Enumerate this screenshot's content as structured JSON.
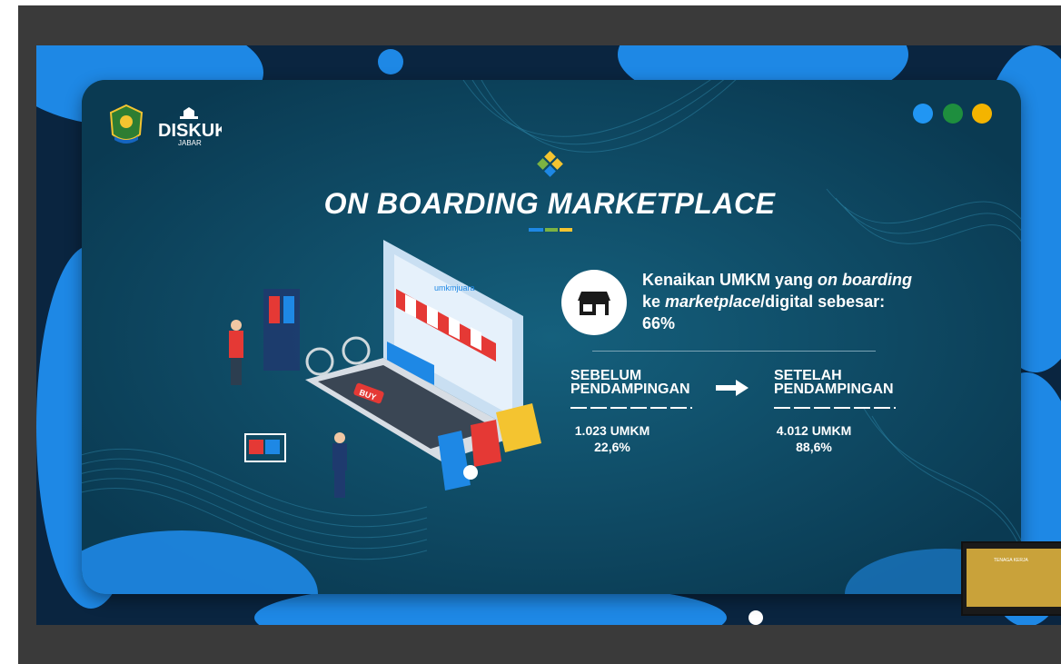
{
  "slide": {
    "title": "ON BOARDING MARKETPLACE",
    "logo_org": "DISKUK",
    "logo_org_sub": "JABAR",
    "stat": {
      "text_1": "Kenaikan UMKM yang ",
      "text_italic_1": "on boarding",
      "text_2": " ke ",
      "text_italic_2": "marketplace",
      "text_3": "/digital sebesar: 66%"
    },
    "before": {
      "heading_1": "SEBELUM",
      "heading_2": "PENDAMPINGAN",
      "count": "1.023 UMKM",
      "percent": "22,6%"
    },
    "after": {
      "heading_1": "SETELAH",
      "heading_2": "PENDAMPINGAN",
      "count": "4.012 UMKM",
      "percent": "88,6%"
    },
    "illustration": {
      "laptop_brand": "umkmjuara",
      "tag_text": "BUY"
    }
  },
  "window_dots": [
    {
      "name": "blue-dot",
      "color": "#2196f3"
    },
    {
      "name": "green-dot",
      "color": "#1e8e3e"
    },
    {
      "name": "yellow-dot",
      "color": "#f4b400"
    }
  ],
  "thumbnail": {
    "title": "TENAGA KERJA"
  },
  "colors": {
    "slide_bg": "#0a2540",
    "card_bg": "#0d4a63",
    "accent_blue": "#1e88e5",
    "accent_yellow": "#f4c430",
    "accent_green": "#7cb342"
  },
  "icons": [
    "store-icon",
    "arrow-right-icon",
    "jabar-emblem-icon",
    "diskuk-logo-icon",
    "diamond-logo-icon"
  ]
}
